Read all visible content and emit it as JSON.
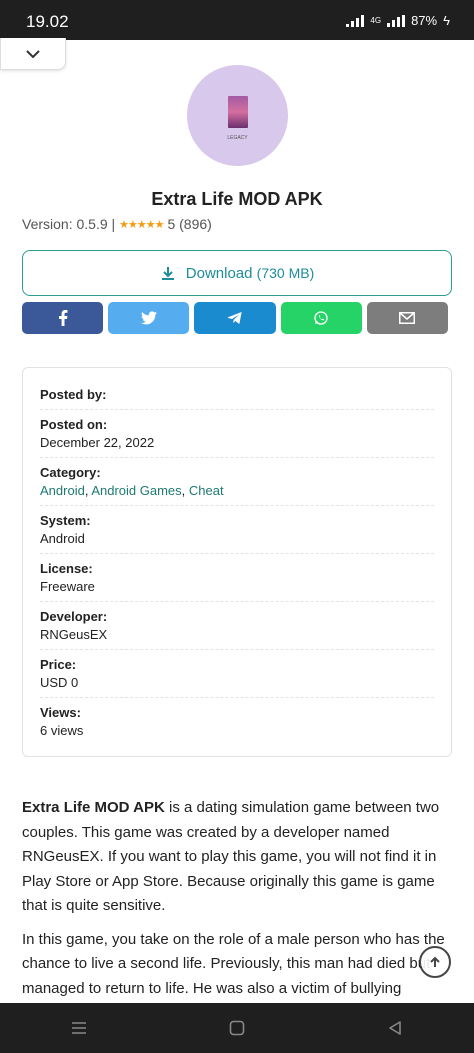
{
  "status_bar": {
    "time": "19.02",
    "network": "4G",
    "battery": "87%"
  },
  "app": {
    "icon_caption": "LEGACY",
    "title": "Extra Life MOD APK",
    "version_label": "Version: 0.5.9 |",
    "rating_stars": "★★★★★",
    "rating_text": "5 (896)"
  },
  "download": {
    "label": "Download",
    "size": "(730 MB)"
  },
  "share": [
    {
      "name": "facebook",
      "color": "#3b5998"
    },
    {
      "name": "twitter",
      "color": "#55acee"
    },
    {
      "name": "telegram",
      "color": "#1b8bcf"
    },
    {
      "name": "whatsapp",
      "color": "#25d366"
    },
    {
      "name": "email",
      "color": "#7d7d7d"
    }
  ],
  "info": {
    "posted_by": {
      "label": "Posted by:"
    },
    "posted_on": {
      "label": "Posted on:",
      "value": "December 22, 2022"
    },
    "category": {
      "label": "Category:",
      "links": [
        "Android",
        "Android Games",
        "Cheat"
      ]
    },
    "system": {
      "label": "System:",
      "value": "Android"
    },
    "license": {
      "label": "License:",
      "value": "Freeware"
    },
    "developer": {
      "label": "Developer:",
      "value": "RNGeusEX"
    },
    "price": {
      "label": "Price:",
      "value": "USD 0"
    },
    "views": {
      "label": "Views:",
      "value": "6 views"
    }
  },
  "article": {
    "p1_bold": "Extra Life MOD APK",
    "p1_rest": " is a dating simulation game between two couples. This game was created by a developer named RNGeusEX. If you want to play this game, you will not find it in Play Store or App Store. Because originally this game is game that is quite sensitive.",
    "p2": "In this game, you take on the role of a male person who has the chance to live a second life. Previously, this man had died but managed to return to life. He was also a victim of bullying"
  }
}
